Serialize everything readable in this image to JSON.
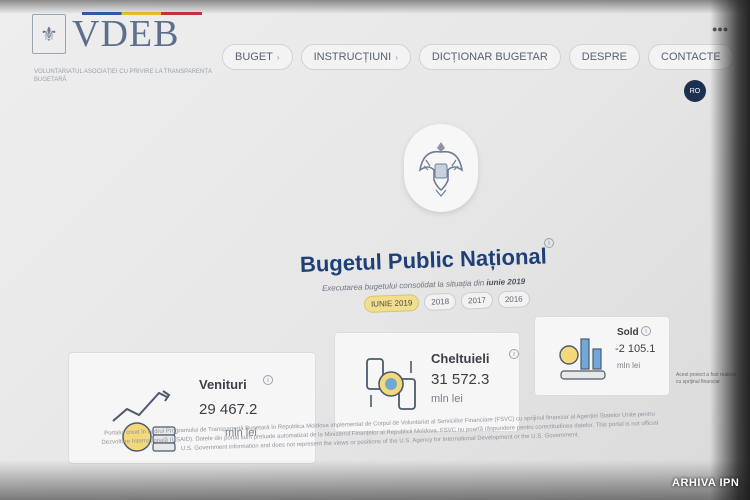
{
  "header": {
    "logo_text": "VDEB",
    "logo_subtitle": "VOLUNTARIATUL ASOCIAȚIEI CU PRIVIRE LA TRANSPARENȚA BUGETARĂ",
    "lang": "RO",
    "top_right": "●●●"
  },
  "nav": [
    {
      "label": "BUGET",
      "has_caret": true
    },
    {
      "label": "INSTRUCȚIUNI",
      "has_caret": true
    },
    {
      "label": "DICȚIONAR BUGETAR",
      "has_caret": false
    },
    {
      "label": "DESPRE",
      "has_caret": false
    },
    {
      "label": "CONTACTE",
      "has_caret": false
    }
  ],
  "hero": {
    "title": "Bugetul Public Național",
    "subtitle_prefix": "Executarea bugetului consolidat la situația din",
    "subtitle_date": "iunie 2019",
    "years": [
      "IUNIE 2019",
      "2018",
      "2017",
      "2016"
    ],
    "active_year": "IUNIE 2019"
  },
  "cards": {
    "venituri": {
      "name": "Venituri",
      "value": "29 467.2",
      "unit": "mln lei"
    },
    "cheltuieli": {
      "name": "Cheltuieli",
      "value": "31 572.3",
      "unit": "mln lei"
    },
    "sold": {
      "name": "Sold",
      "value": "-2 105.1",
      "unit": "mln lei"
    }
  },
  "side_note": "Acest proiect a fost realizat cu sprijinul financiar",
  "disclaimer": "Portalul creat în cadrul Programului de Transparență Bugetară în Republica Moldova implementat de Corpul de Voluntariat al Serviciilor Financiare (FSVC) cu sprijinul financiar al Agenției Statelor Unite pentru Dezvoltare Internațională (USAID). Datele din portal sunt preluate automatizat de la Ministerul Finanțelor al Republicii Moldova. FSVC nu poartă răspundere pentru corectitudinea datelor. This portal is not official U.S. Government information and does not represent the views or positions of the U.S. Agency for International Development or the U.S. Government.",
  "credit": "ARHIVA IPN",
  "colors": {
    "accent": "#1f3f78",
    "active_year": "#f1df8f",
    "lang_badge": "#1d3050"
  }
}
